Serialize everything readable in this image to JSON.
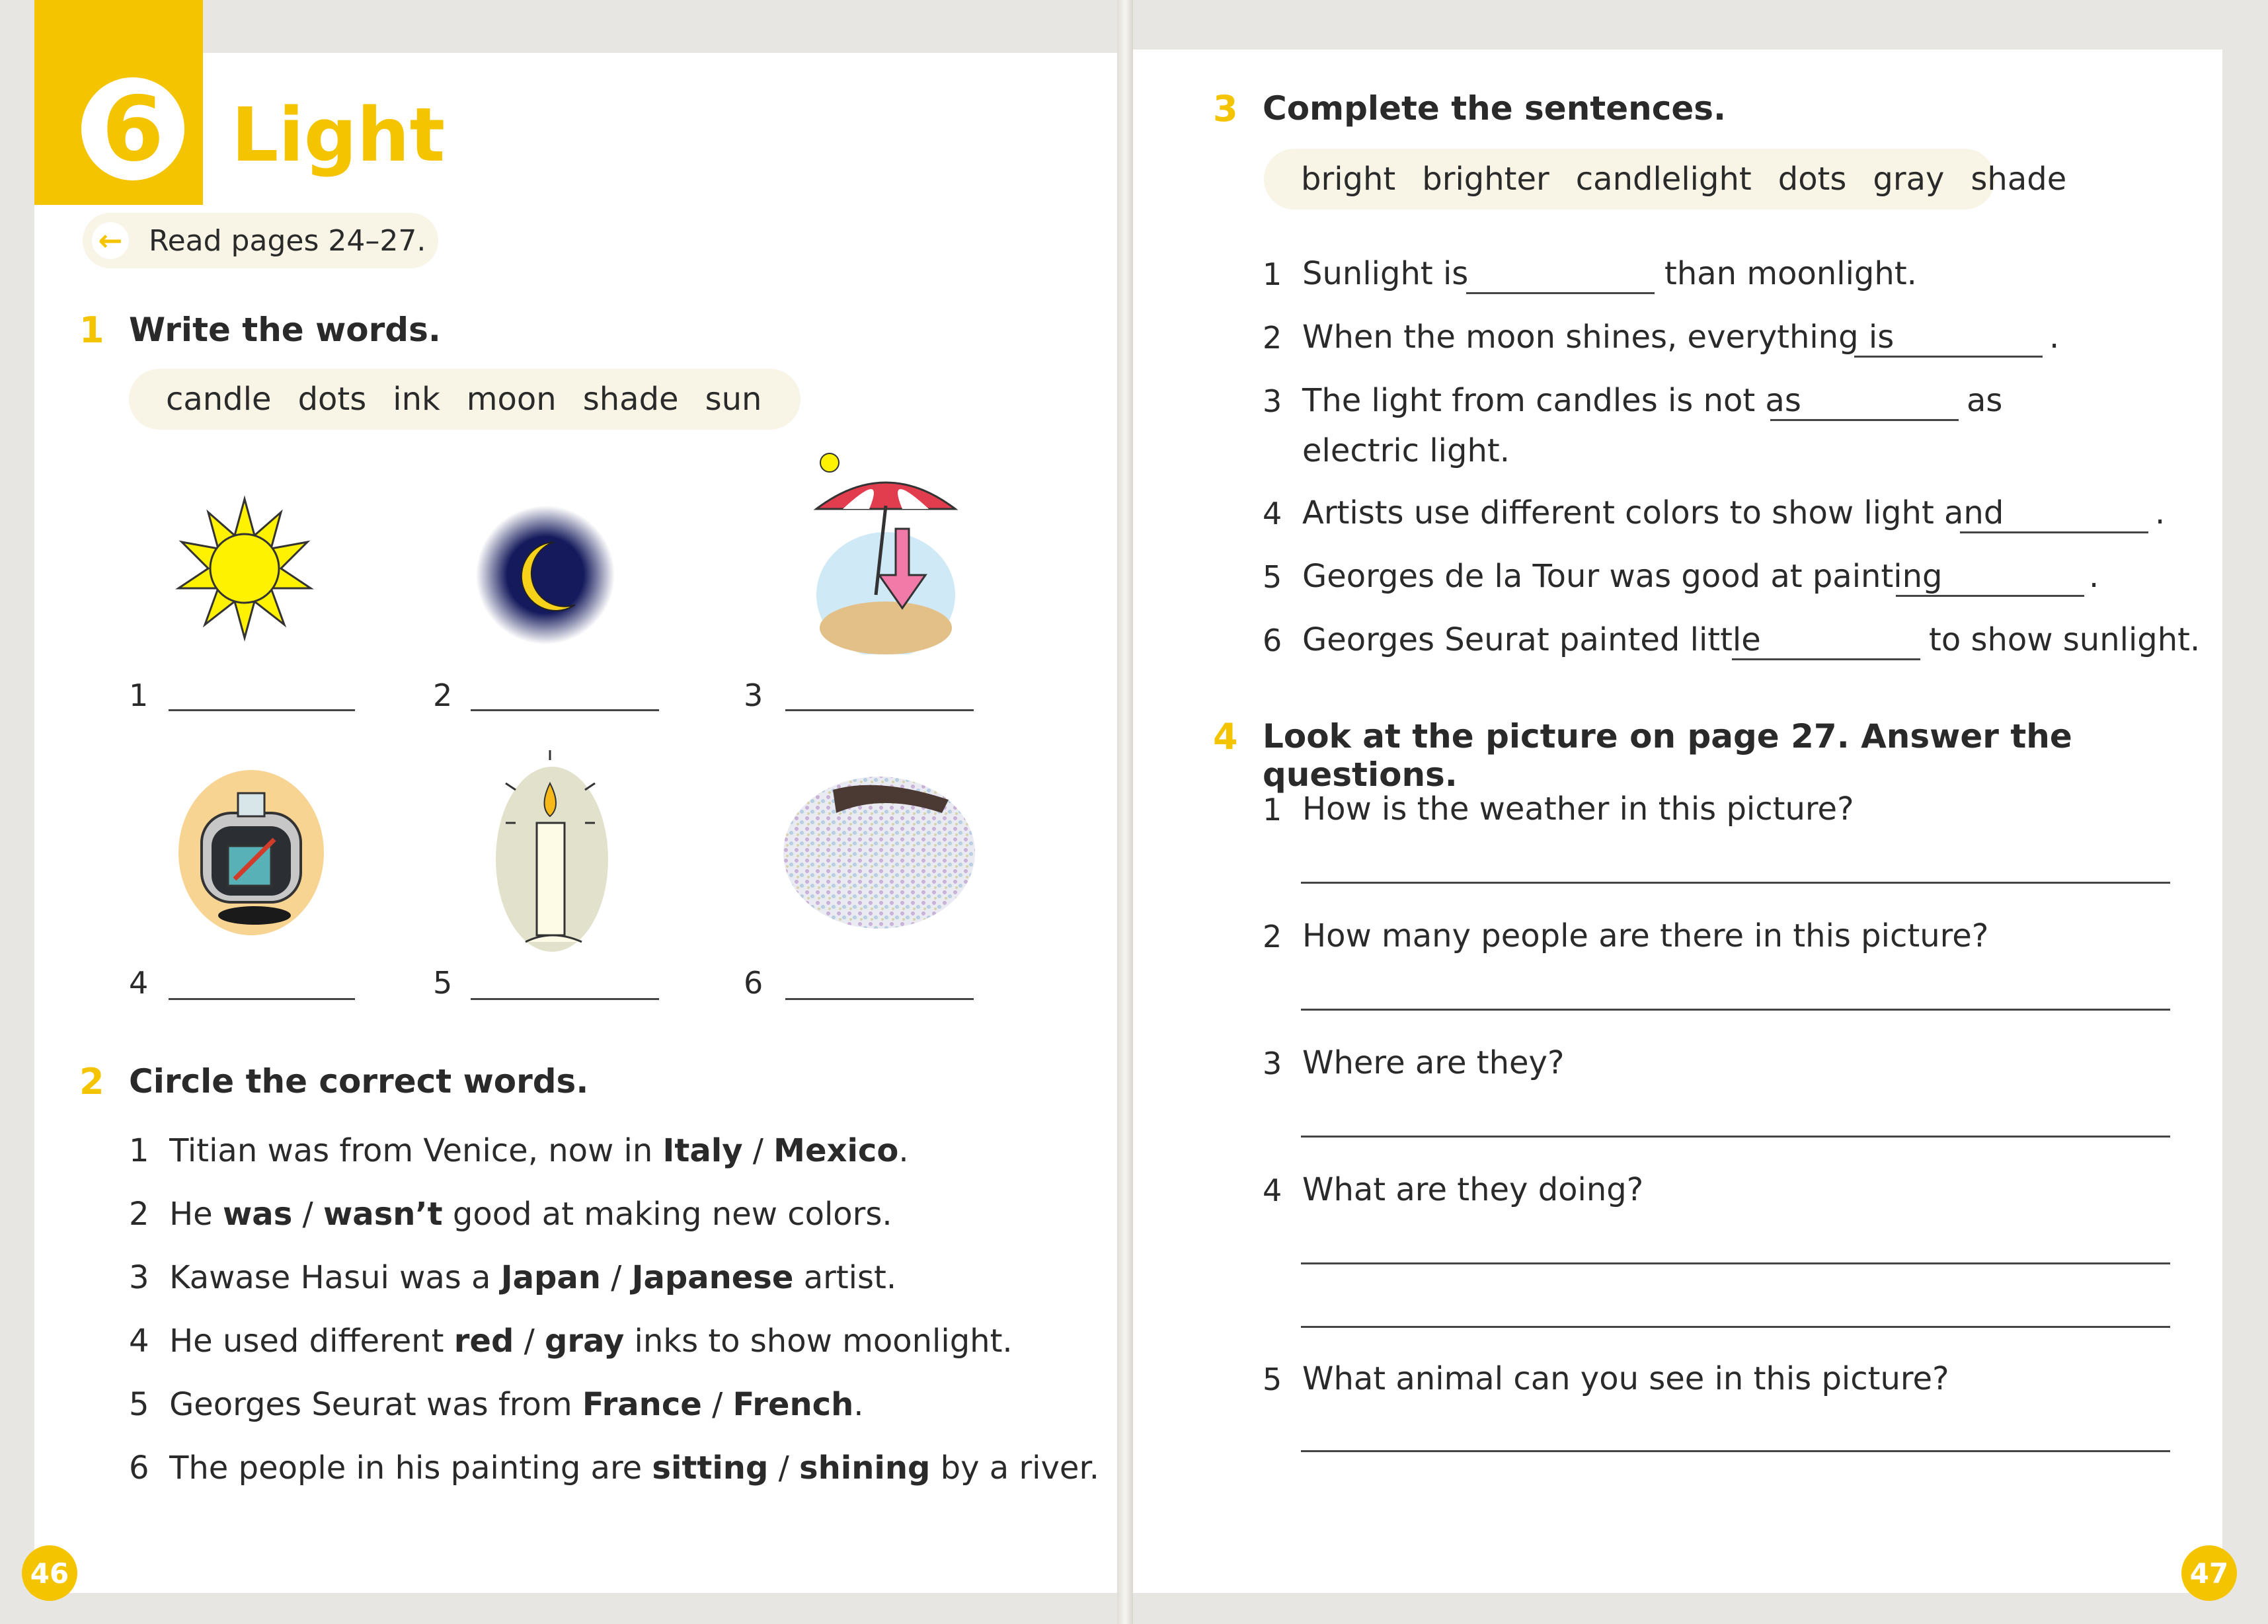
{
  "unit": {
    "number": "6",
    "title": "Light"
  },
  "read_pages": "Read pages 24–27.",
  "ex1": {
    "num": "1",
    "title": "Write the words.",
    "words": [
      "candle",
      "dots",
      "ink",
      "moon",
      "shade",
      "sun"
    ],
    "items": [
      "1",
      "2",
      "3",
      "4",
      "5",
      "6"
    ],
    "icons": [
      "sun-icon",
      "moon-icon",
      "beach-umbrella-shade-icon",
      "ink-bottle-icon",
      "candle-icon",
      "dots-painting-icon"
    ]
  },
  "ex2": {
    "num": "2",
    "title": "Circle the correct words.",
    "items": [
      {
        "n": "1",
        "pre": "Titian was from Venice, now in ",
        "a": "Italy",
        "b": "Mexico",
        "post": "."
      },
      {
        "n": "2",
        "pre": "He ",
        "a": "was",
        "b": "wasn’t",
        "post": " good at making new colors."
      },
      {
        "n": "3",
        "pre": "Kawase Hasui was a ",
        "a": "Japan",
        "b": "Japanese",
        "post": " artist."
      },
      {
        "n": "4",
        "pre": "He used different ",
        "a": "red",
        "b": "gray",
        "post": " inks to show moonlight."
      },
      {
        "n": "5",
        "pre": "Georges Seurat was from ",
        "a": "France",
        "b": "French",
        "post": "."
      },
      {
        "n": "6",
        "pre": "The people in his painting are ",
        "a": "sitting",
        "b": "shining",
        "post": " by a river."
      }
    ],
    "slash": " / "
  },
  "ex3": {
    "num": "3",
    "title": "Complete the sentences.",
    "words": [
      "bright",
      "brighter",
      "candlelight",
      "dots",
      "gray",
      "shade"
    ],
    "items": [
      {
        "n": "1",
        "pre": "Sunlight is",
        "post": "than moonlight."
      },
      {
        "n": "2",
        "pre": "When the moon shines, everything is",
        "post": "."
      },
      {
        "n": "3",
        "pre": "The light from candles is not as",
        "post": "as",
        "cont": "electric light."
      },
      {
        "n": "4",
        "pre": "Artists use different colors to show light and",
        "post": "."
      },
      {
        "n": "5",
        "pre": "Georges de la Tour was good at painting",
        "post": "."
      },
      {
        "n": "6",
        "pre": "Georges Seurat painted little",
        "post": "to show sunlight."
      }
    ]
  },
  "ex4": {
    "num": "4",
    "title": "Look at the picture on page 27. Answer the questions.",
    "items": [
      {
        "n": "1",
        "q": "How is the weather in this picture?"
      },
      {
        "n": "2",
        "q": "How many people are there in this picture?"
      },
      {
        "n": "3",
        "q": "Where are they?"
      },
      {
        "n": "4",
        "q": "What are they doing?"
      },
      {
        "n": "5",
        "q": "What animal can you see in this picture?"
      }
    ]
  },
  "page_numbers": {
    "left": "46",
    "right": "47"
  },
  "colors": {
    "accent": "#f5c400",
    "pill": "#f8f4e6",
    "text": "#2a2a2a"
  }
}
